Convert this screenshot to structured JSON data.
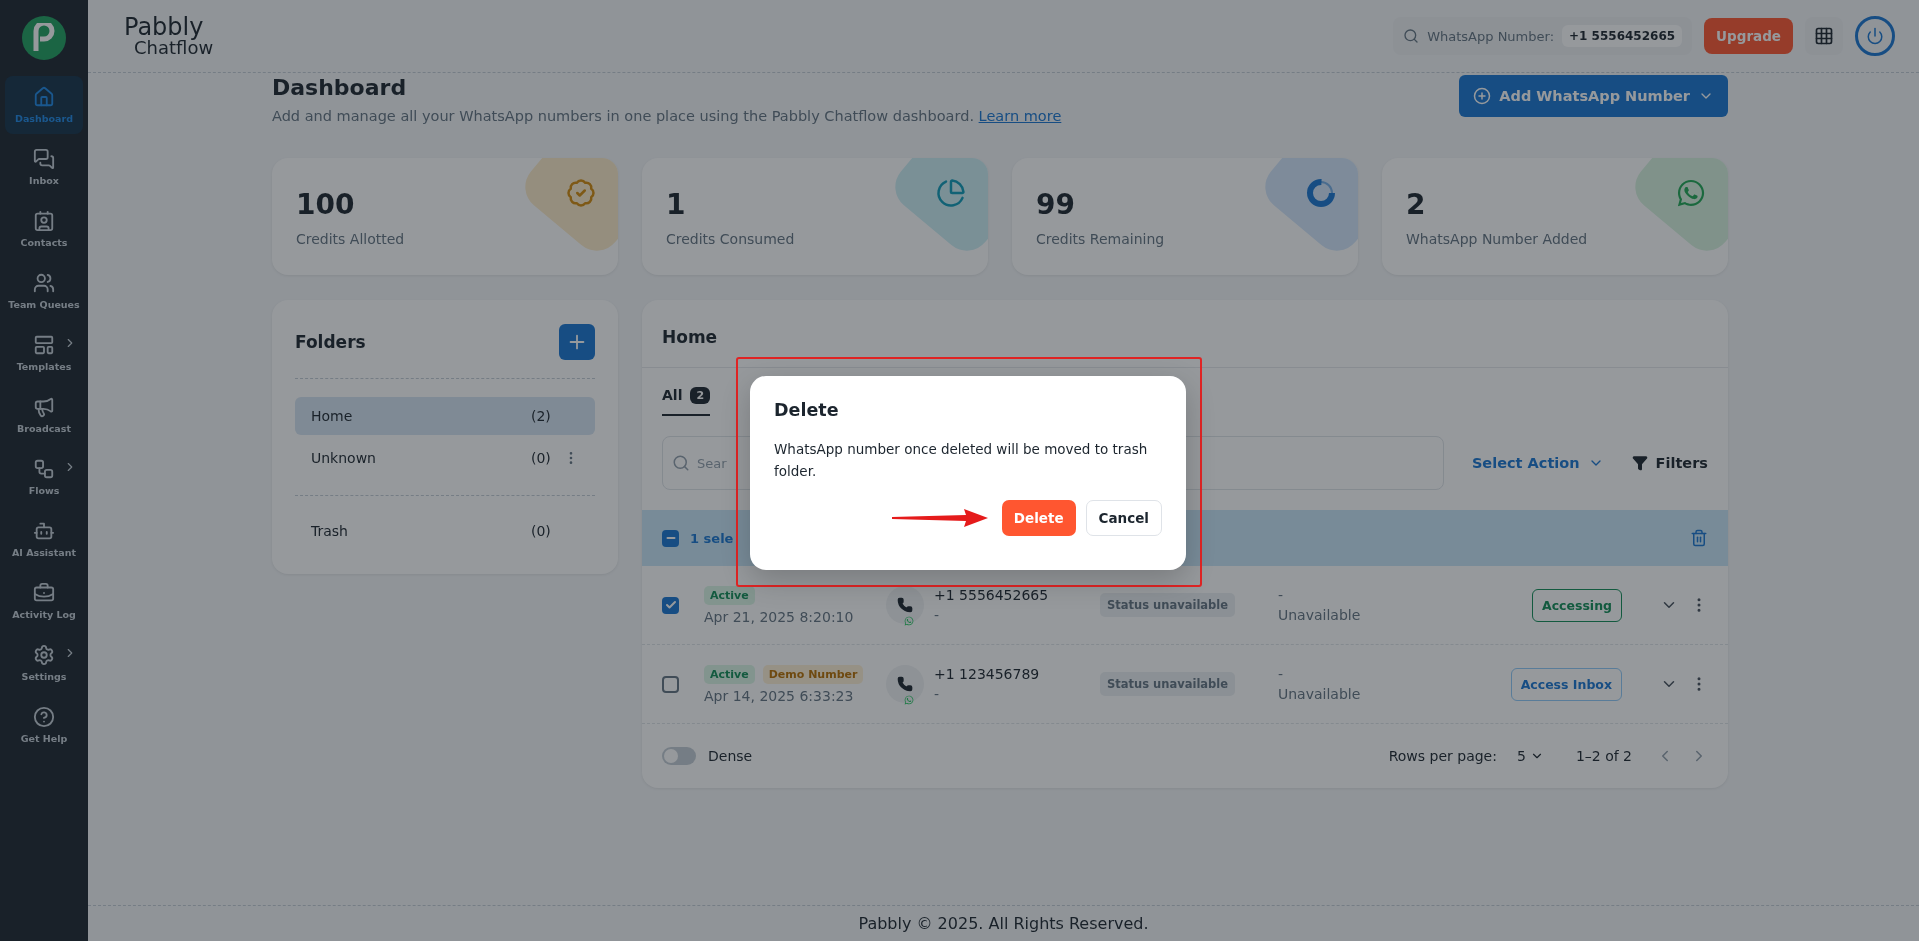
{
  "sidebar": {
    "items": [
      {
        "label": "Dashboard",
        "selected": true,
        "submenu": false
      },
      {
        "label": "Inbox",
        "selected": false,
        "submenu": false
      },
      {
        "label": "Contacts",
        "selected": false,
        "submenu": false
      },
      {
        "label": "Team Queues",
        "selected": false,
        "submenu": false
      },
      {
        "label": "Templates",
        "selected": false,
        "submenu": true
      },
      {
        "label": "Broadcast",
        "selected": false,
        "submenu": false
      },
      {
        "label": "Flows",
        "selected": false,
        "submenu": true
      },
      {
        "label": "AI Assistant",
        "selected": false,
        "submenu": false
      },
      {
        "label": "Activity Log",
        "selected": false,
        "submenu": false
      },
      {
        "label": "Settings",
        "selected": false,
        "submenu": true
      },
      {
        "label": "Get Help",
        "selected": false,
        "submenu": false
      }
    ]
  },
  "header": {
    "brand": "Pabbly",
    "brand_sub": "Chatflow",
    "search_label": "WhatsApp Number:",
    "search_value": "+1 5556452665",
    "upgrade": "Upgrade"
  },
  "page": {
    "title": "Dashboard",
    "subtitle": "Add and manage all your WhatsApp numbers in one place using the Pabbly Chatflow dashboard.",
    "learn_more": "Learn more",
    "add_button": "Add WhatsApp Number"
  },
  "stats": [
    {
      "value": "100",
      "label": "Credits Allotted",
      "kind": "badge"
    },
    {
      "value": "1",
      "label": "Credits Consumed",
      "kind": "pie"
    },
    {
      "value": "99",
      "label": "Credits Remaining",
      "kind": "donut"
    },
    {
      "value": "2",
      "label": "WhatsApp Number Added",
      "kind": "whatsapp"
    }
  ],
  "folders": {
    "title": "Folders",
    "items": [
      {
        "name": "Home",
        "count": "(2)",
        "selected": true,
        "menu": false
      },
      {
        "name": "Unknown",
        "count": "(0)",
        "selected": false,
        "menu": true
      }
    ],
    "trash": {
      "name": "Trash",
      "count": "(0)"
    }
  },
  "panel": {
    "title": "Home",
    "tabs": [
      {
        "label": "All",
        "count": "2",
        "selected": true
      }
    ],
    "search_placeholder": "Sear",
    "select_action": "Select Action",
    "filters": "Filters",
    "selection": {
      "indeterminate": true,
      "text": "1 sele"
    },
    "rows": [
      {
        "checked": true,
        "badges": [
          {
            "label": "Active",
            "kind": "active"
          }
        ],
        "date": "Apr 21, 2025 8:20:10",
        "phone": "+1 5556452665",
        "phone_sub": "-",
        "status": "Status unavailable",
        "column_4_top": "-",
        "column_4": "Unavailable",
        "action": "Accessing",
        "kind": "accessing"
      },
      {
        "checked": false,
        "badges": [
          {
            "label": "Active",
            "kind": "active"
          },
          {
            "label": "Demo Number",
            "kind": "demo"
          }
        ],
        "date": "Apr 14, 2025 6:33:23",
        "phone": "+1 123456789",
        "phone_sub": "-",
        "status": "Status unavailable",
        "column_4_top": "-",
        "column_4": "Unavailable",
        "action": "Access Inbox",
        "kind": "inbox"
      }
    ],
    "dense": {
      "label": "Dense",
      "on": false
    },
    "rows_per_page_label": "Rows per page:",
    "rows_per_page": "5",
    "range": "1–2 of 2"
  },
  "dialog": {
    "title": "Delete",
    "message": "WhatsApp number once deleted will be moved to trash folder.",
    "confirm": "Delete",
    "cancel": "Cancel"
  },
  "footer": "Pabbly © 2025. All Rights Reserved."
}
